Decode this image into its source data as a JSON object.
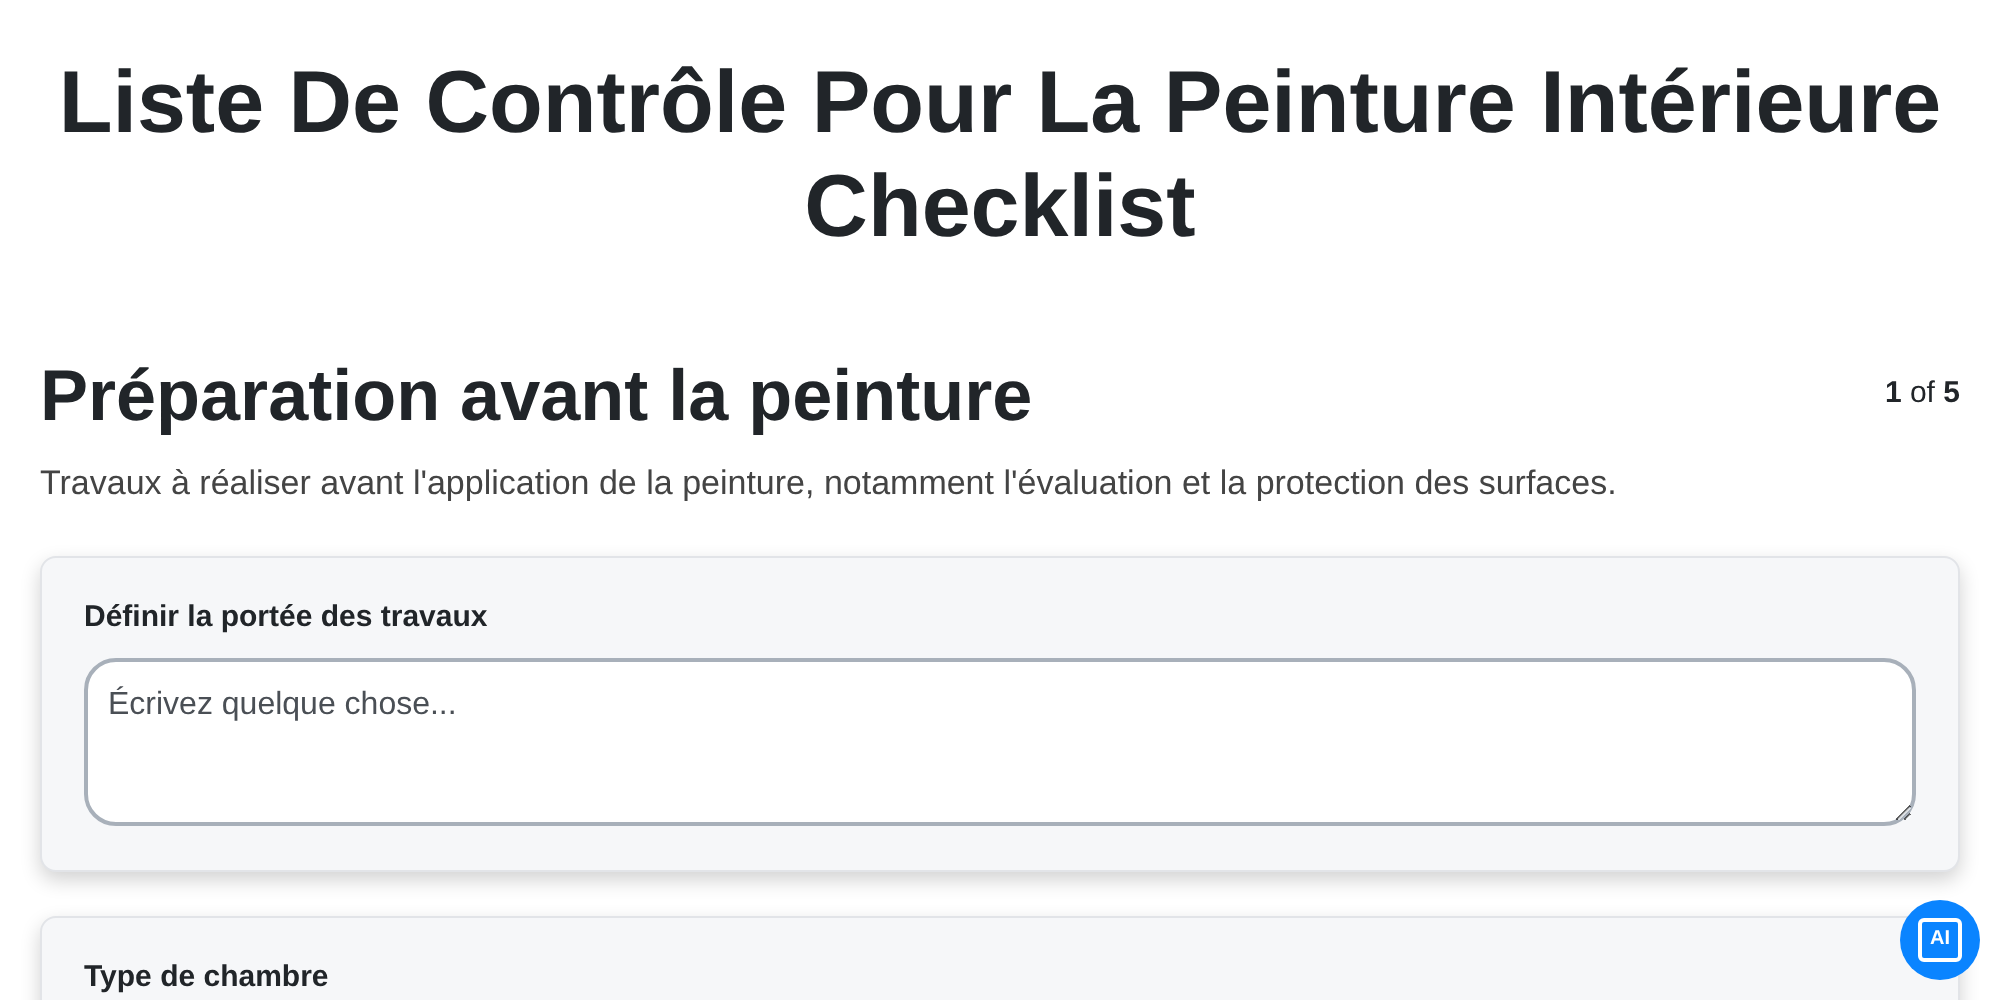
{
  "title": "Liste De Contrôle Pour La Peinture Intérieure Checklist",
  "section": {
    "heading": "Préparation avant la peinture",
    "page": {
      "current": "1",
      "separator": "of",
      "total": "5"
    },
    "description": "Travaux à réaliser avant l'application de la peinture, notamment l'évaluation et la protection des surfaces."
  },
  "questions": [
    {
      "label": "Définir la portée des travaux",
      "kind": "textarea",
      "placeholder": "Écrivez quelque chose..."
    },
    {
      "label": "Type de chambre",
      "kind": "choice"
    }
  ],
  "ai_button": {
    "label": "AI"
  }
}
